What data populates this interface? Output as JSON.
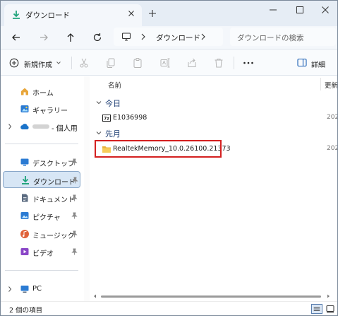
{
  "window": {
    "tab_title": "ダウンロード",
    "colors": {
      "accent": "#1a73c9",
      "folder": "#f5c542",
      "highlight": "#d42020",
      "group": "#1d3e74"
    }
  },
  "nav": {
    "address_label": "ダウンロード",
    "search_placeholder": "ダウンロードの検索"
  },
  "toolbar": {
    "new_label": "新規作成",
    "details_label": "詳細",
    "icons": [
      "cut-icon",
      "copy-icon",
      "paste-icon",
      "rename-icon",
      "share-icon",
      "delete-icon",
      "more-icon"
    ]
  },
  "sidebar": {
    "items": [
      {
        "label": "ホーム",
        "icon": "home-icon"
      },
      {
        "label": "ギャラリー",
        "icon": "gallery-icon"
      },
      {
        "label": "- 個人用",
        "icon": "cloud-icon"
      },
      {
        "label": "デスクトップ",
        "icon": "desktop-icon"
      },
      {
        "label": "ダウンロード",
        "icon": "download-icon"
      },
      {
        "label": "ドキュメント",
        "icon": "documents-icon"
      },
      {
        "label": "ピクチャ",
        "icon": "pictures-icon"
      },
      {
        "label": "ミュージック",
        "icon": "music-icon"
      },
      {
        "label": "ビデオ",
        "icon": "videos-icon"
      },
      {
        "label": "PC",
        "icon": "pc-icon"
      }
    ]
  },
  "content": {
    "col_name": "名前",
    "col_date": "更新",
    "groups": [
      {
        "label": "今日",
        "files": [
          {
            "name": "E1036998",
            "date": "202",
            "icon": "7zip-archive-icon"
          }
        ]
      },
      {
        "label": "先月",
        "files": [
          {
            "name": "RealtekMemory_10.0.26100.21373",
            "date": "202",
            "icon": "folder-icon"
          }
        ]
      }
    ]
  },
  "status": {
    "item_count": "2 個の項目"
  }
}
